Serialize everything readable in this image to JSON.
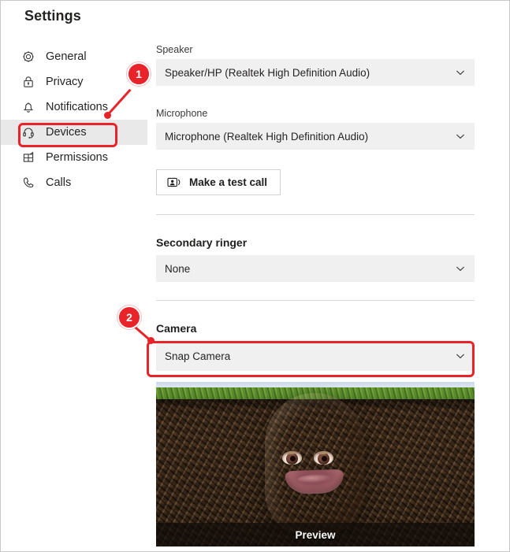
{
  "window": {
    "title": "Settings",
    "border_color": "#c8c8c8"
  },
  "sidebar": {
    "items": [
      {
        "label": "General",
        "icon": "gear-icon",
        "selected": false
      },
      {
        "label": "Privacy",
        "icon": "lock-icon",
        "selected": false
      },
      {
        "label": "Notifications",
        "icon": "bell-icon",
        "selected": false
      },
      {
        "label": "Devices",
        "icon": "headset-icon",
        "selected": true
      },
      {
        "label": "Permissions",
        "icon": "permissions-icon",
        "selected": false
      },
      {
        "label": "Calls",
        "icon": "phone-icon",
        "selected": false
      }
    ]
  },
  "main": {
    "speaker": {
      "label": "Speaker",
      "value": "Speaker/HP (Realtek High Definition Audio)",
      "chevron": "chevron-down-icon"
    },
    "microphone": {
      "label": "Microphone",
      "value": "Microphone (Realtek High Definition Audio)",
      "chevron": "chevron-down-icon"
    },
    "test_call": {
      "label": "Make a test call",
      "icon": "test-call-icon"
    },
    "secondary_ringer": {
      "heading": "Secondary ringer",
      "value": "None",
      "chevron": "chevron-down-icon"
    },
    "camera": {
      "heading": "Camera",
      "value": "Snap Camera",
      "chevron": "chevron-down-icon"
    },
    "preview": {
      "caption": "Preview",
      "scene": "potato-filter-in-soil"
    }
  },
  "annotations": {
    "color": "#e8232a",
    "markers": [
      {
        "number": "1",
        "targets": "sidebar-item-devices"
      },
      {
        "number": "2",
        "targets": "camera-dropdown"
      }
    ]
  }
}
